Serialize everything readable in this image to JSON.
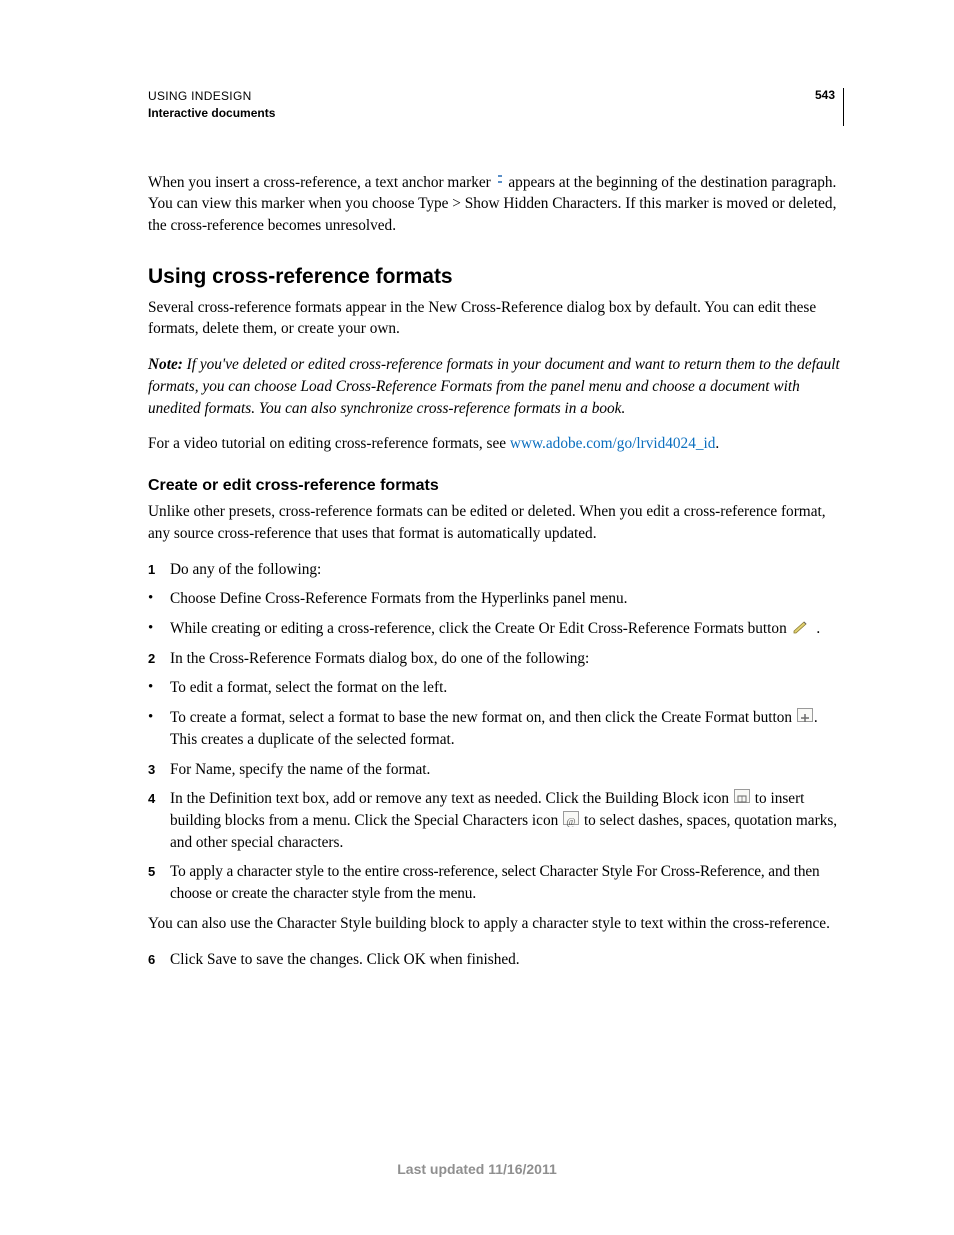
{
  "header": {
    "line1": "USING INDESIGN",
    "line2": "Interactive documents",
    "page_number": "543"
  },
  "intro": {
    "p1a": "When you insert a cross-reference, a text anchor marker ",
    "p1b": " appears at the beginning of the destination paragraph. You can view this marker when you choose Type > Show Hidden Characters. If this marker is moved or deleted, the cross-reference becomes unresolved."
  },
  "section": {
    "h2": "Using cross-reference formats",
    "p1": "Several cross-reference formats appear in the New Cross-Reference dialog box by default. You can edit these formats, delete them, or create your own.",
    "note_label": "Note:",
    "note_body": " If you've deleted or edited cross-reference formats in your document and want to return them to the default formats, you can choose Load Cross-Reference Formats from the panel menu and choose a document with unedited formats. You can also synchronize cross-reference formats in a book.",
    "p3a": "For a video tutorial on editing cross-reference formats, see ",
    "link_text": "www.adobe.com/go/lrvid4024_id",
    "p3b": "."
  },
  "subsection": {
    "h3": "Create or edit cross-reference formats",
    "p1": "Unlike other presets, cross-reference formats can be edited or deleted. When you edit a cross-reference format, any source cross-reference that uses that format is automatically updated.",
    "steps": {
      "s1": "Do any of the following:",
      "b1": "Choose Define Cross-Reference Formats from the Hyperlinks panel menu.",
      "b2a": "While creating or editing a cross-reference, click the Create Or Edit Cross-Reference Formats button ",
      "b2b": " .",
      "s2": "In the Cross-Reference Formats dialog box, do one of the following:",
      "b3": "To edit a format, select the format on the left.",
      "b4a": "To create a format, select a format to base the new format on, and then click the Create Format button ",
      "b4b": ". This creates a duplicate of the selected format.",
      "s3": "For Name, specify the name of the format.",
      "s4a": "In the Definition text box, add or remove any text as needed. Click the Building Block icon ",
      "s4b": " to insert building blocks from a menu. Click the Special Characters icon ",
      "s4c": " to select dashes, spaces, quotation marks, and other special characters.",
      "s5": "To apply a character style to the entire cross-reference, select Character Style For Cross-Reference, and then choose or create the character style from the menu.",
      "after5": "You can also use the Character Style building block to apply a character style to text within the cross-reference.",
      "s6": "Click Save to save the changes. Click OK when finished."
    }
  },
  "footer": "Last updated 11/16/2011"
}
